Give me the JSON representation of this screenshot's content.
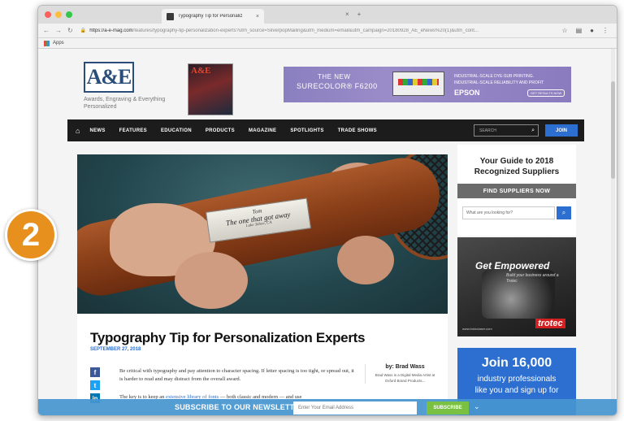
{
  "browser": {
    "tab_title": "Typography Tip for Personaliz",
    "url_domain": "https://a-e-mag.com",
    "url_path": "/features/typography-tip-personalization-experts?utm_source=SilverpopMailing&utm_medium=email&utm_campaign=20180928_AE_eNews%20(1)&utm_cont...",
    "bookmark_apps": "Apps"
  },
  "site": {
    "logo": "A&E",
    "tagline": "Awards, Engraving & Everything Personalized",
    "magazine_title": "A&E"
  },
  "ad": {
    "line1": "THE NEW",
    "line2": "SURECOLOR® F6200",
    "right_text": "INDUSTRIAL-SCALE DYE-SUB PRINTING. INDUSTRIAL-SCALE RELIABILITY AND PROFIT",
    "brand": "EPSON",
    "cta": "GET RESULTS NOW"
  },
  "nav": {
    "items": [
      "NEWS",
      "FEATURES",
      "EDUCATION",
      "PRODUCTS",
      "MAGAZINE",
      "SPOTLIGHTS",
      "TRADE SHOWS"
    ],
    "search_placeholder": "SEARCH",
    "join": "JOIN"
  },
  "hero": {
    "plate_line1": "Tom",
    "plate_line2": "The one that got away",
    "plate_line3": "Lake Tahoe, CA"
  },
  "article": {
    "title": "Typography Tip for Personalization Experts",
    "date": "SEPTEMBER 27, 2018",
    "p1": "Be critical with typography and pay attention to character spacing. If letter spacing is too tight, or spread out, it is harder to read and may distract from the overall award.",
    "p2_pre": "The key is to keep an ",
    "p2_link": "extensive library of fonts",
    "p2_post": " — both classic and modern — and use",
    "byline": "by: Brad Wass",
    "bio": "Brad Wass is a Digital Media Artist at Oxford Brand Products..."
  },
  "sidebar": {
    "guide_line1": "Your Guide to 2018",
    "guide_line2": "Recognized Suppliers",
    "find_button": "FIND SUPPLIERS NOW",
    "find_placeholder": "What are you looking for?",
    "promo_title": "Get Empowered",
    "promo_sub": "Build your business around a Trotec",
    "promo_brand": "trotec",
    "promo_url": "www.troteclaser.com",
    "join_title": "Join 16,000",
    "join_line2": "industry professionals",
    "join_line3": "like you and sign up for"
  },
  "newsletter": {
    "label": "SUBSCRIBE TO OUR NEWSLETTER",
    "placeholder": "Enter Your Email Address",
    "button": "SUBSCRIBE"
  },
  "step_badge": "2",
  "colors": {
    "nav_bg": "#1c1c1c",
    "accent_blue": "#2c6fd1",
    "newsletter_bg": "#4696d0",
    "subscribe_green": "#7ac143",
    "badge_orange": "#e8901e"
  }
}
